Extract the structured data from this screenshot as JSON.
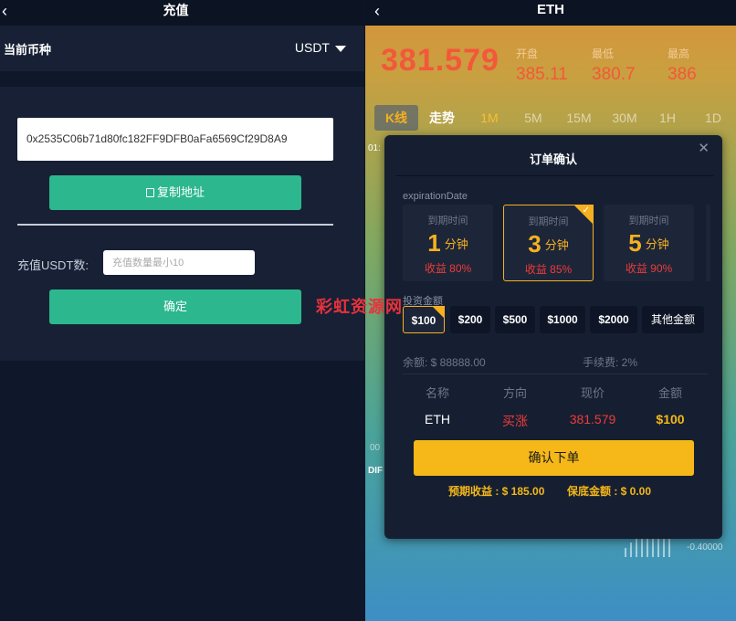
{
  "left": {
    "back_glyph": "‹",
    "title": "充值",
    "currency_label": "当前币种",
    "currency_value": "USDT",
    "address": "0x2535C06b71d80fc182FF9DFB0aFa6569Cf29D8A9",
    "copy_button": "复制地址",
    "amount_label": "充值USDT数:",
    "amount_placeholder": "充值数量最小10",
    "amount_value": "",
    "confirm_button": "确定"
  },
  "right": {
    "back_glyph": "‹",
    "title": "ETH",
    "price": "381.579",
    "stats": [
      {
        "label": "开盘",
        "value": "385.11"
      },
      {
        "label": "最低",
        "value": "380.7"
      },
      {
        "label": "最高",
        "value": "386"
      }
    ],
    "tabs": [
      "K线",
      "走势",
      "1M",
      "5M",
      "15M",
      "30M",
      "1H",
      "1D"
    ],
    "side_label_top": "01:",
    "side_label_mid": "00",
    "side_label_dif": "DIF",
    "axis_value": "-0.40000"
  },
  "modal": {
    "title": "订单确认",
    "close_glyph": "✕",
    "expiration_label": "expirationDate",
    "options": [
      {
        "time_label": "到期时间",
        "minutes": "1",
        "unit": "分钟",
        "profit": "收益 80%"
      },
      {
        "time_label": "到期时间",
        "minutes": "3",
        "unit": "分钟",
        "profit": "收益 85%"
      },
      {
        "time_label": "到期时间",
        "minutes": "5",
        "unit": "分钟",
        "profit": "收益 90%"
      }
    ],
    "amount_label": "投资金额",
    "chips": [
      "$100",
      "$200",
      "$500",
      "$1000",
      "$2000",
      "其他金额"
    ],
    "balance": "余额: $ 88888.00",
    "fee": "手续费:  2%",
    "table": {
      "headers": [
        "名称",
        "方向",
        "现价",
        "金额"
      ],
      "values": [
        "ETH",
        "买涨",
        "381.579",
        "$100"
      ]
    },
    "confirm_button": "确认下单",
    "expected_profit": "预期收益 : $ 185.00",
    "margin_amount": "保底金额 : $ 0.00",
    "colors": {
      "accent": "#f5b818",
      "profit_red": "#ee3b3b",
      "green": "#2cb78e"
    }
  },
  "watermark": "彩虹资源网"
}
